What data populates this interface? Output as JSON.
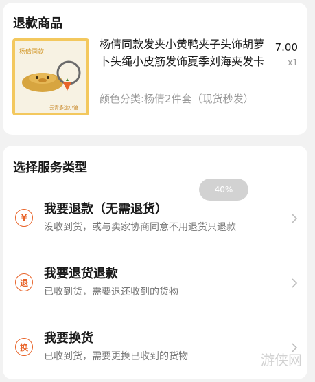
{
  "refund_product": {
    "section_title": "退款商品",
    "thumb_logo": "杨倩同款",
    "thumb_footer": "云青多选小馆",
    "title": "杨倩同款发夹小黄鸭夹子头饰胡萝卜头绳小皮筋发饰夏季刘海夹发卡",
    "price": "7.00",
    "quantity": "x1",
    "sku": "颜色分类:杨倩2件套（现货秒发）"
  },
  "service": {
    "section_title": "选择服务类型",
    "progress_badge": "40%",
    "options": [
      {
        "icon_text": "¥",
        "title": "我要退款（无需退货）",
        "desc": "没收到货，或与卖家协商同意不用退货只退款"
      },
      {
        "icon_text": "退",
        "title": "我要退货退款",
        "desc": "已收到货，需要退还收到的货物"
      },
      {
        "icon_text": "换",
        "title": "我要换货",
        "desc": "已收到货，需要更换已收到的货物"
      }
    ]
  },
  "watermark": "游侠网",
  "colors": {
    "accent": "#e8642a",
    "background": "#f2f2f2",
    "card": "#ffffff"
  }
}
